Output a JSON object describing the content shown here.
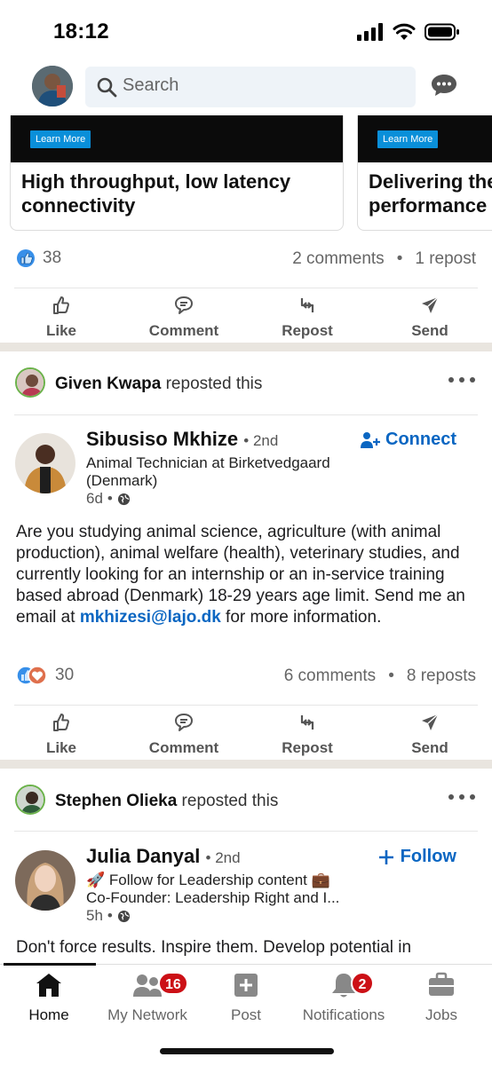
{
  "status_bar": {
    "time": "18:12"
  },
  "header": {
    "search_placeholder": "Search"
  },
  "ad_carousel": {
    "cards": [
      {
        "button": "Learn More",
        "title_line1": "High throughput, low latency",
        "title_line2": "connectivity"
      },
      {
        "button": "Learn More",
        "title_line1": "Delivering the",
        "title_line2": "performance"
      }
    ]
  },
  "post1": {
    "reactions_count": "38",
    "comments": "2 comments",
    "reposts": "1 repost"
  },
  "actions": {
    "like": "Like",
    "comment": "Comment",
    "repost": "Repost",
    "send": "Send"
  },
  "post2": {
    "reposter_name": "Given Kwapa",
    "reposted_text": " reposted this",
    "author_name": "Sibusiso Mkhize",
    "degree": "2nd",
    "headline": "Animal Technician at Birketvedgaard (Denmark)",
    "time": "6d",
    "connect_label": "Connect",
    "body_text": "Are you studying animal science, agriculture (with animal production), animal welfare (health), veterinary studies, and currently looking for an internship or an in-service training based abroad (Denmark) 18-29 years age limit. Send me an email at ",
    "body_link": "mkhizesi@lajo.dk",
    "body_end": " for more information.",
    "reactions_count": "30",
    "comments": "6 comments",
    "reposts": "8 reposts"
  },
  "post3": {
    "reposter_name": "Stephen Olieka",
    "reposted_text": " reposted this",
    "author_name": "Julia Danyal",
    "degree": "2nd",
    "headline_line1": "🚀 Follow for Leadership content 💼",
    "headline_line2": "Co-Founder: Leadership Right and I...",
    "time": "5h",
    "follow_label": "Follow",
    "body_text": "Don't force results. Inspire them. Develop potential in"
  },
  "bottom_nav": {
    "home": "Home",
    "network": "My Network",
    "network_badge": "16",
    "post": "Post",
    "notifications": "Notifications",
    "notifications_badge": "2",
    "jobs": "Jobs"
  },
  "colors": {
    "brand_blue": "#0a66c2",
    "badge_red": "#cc1016",
    "separator": "#e9e5df"
  }
}
